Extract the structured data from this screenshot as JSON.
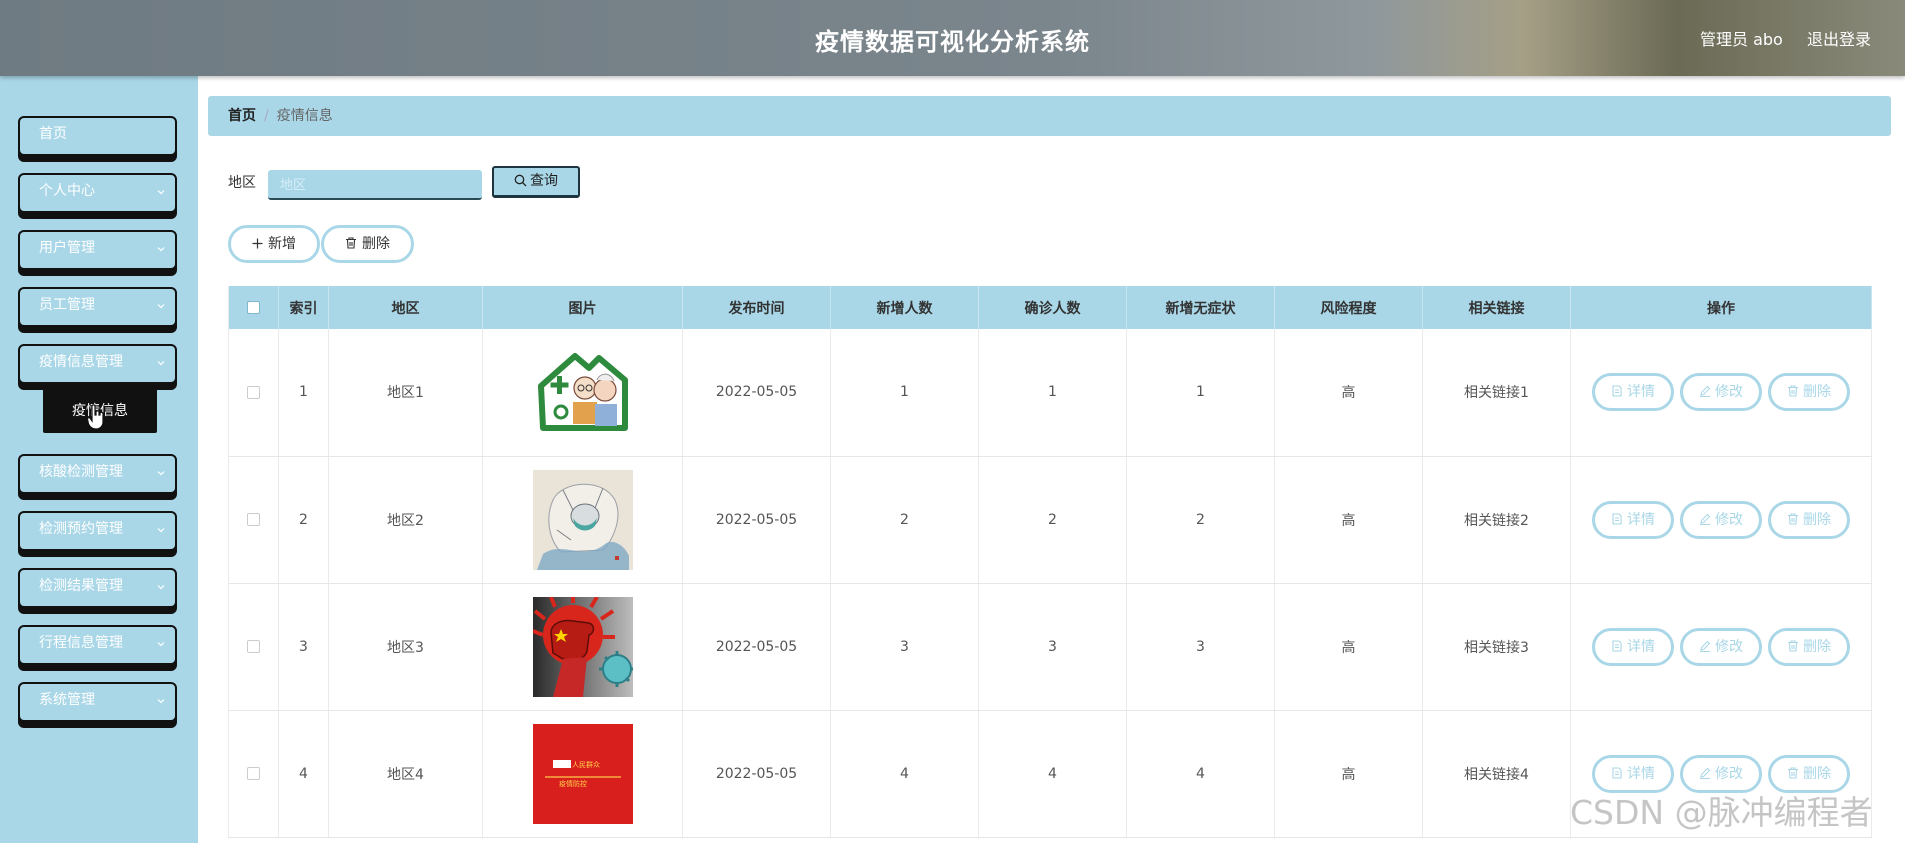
{
  "header": {
    "title": "疫情数据可视化分析系统",
    "user": "管理员 abo",
    "logout": "退出登录"
  },
  "sidebar": {
    "items": [
      {
        "label": "首页",
        "has_arrow": false
      },
      {
        "label": "个人中心",
        "has_arrow": true
      },
      {
        "label": "用户管理",
        "has_arrow": true
      },
      {
        "label": "员工管理",
        "has_arrow": true
      },
      {
        "label": "疫情信息管理",
        "has_arrow": true
      },
      {
        "label": "核酸检测管理",
        "has_arrow": true
      },
      {
        "label": "检测预约管理",
        "has_arrow": true
      },
      {
        "label": "检测结果管理",
        "has_arrow": true
      },
      {
        "label": "行程信息管理",
        "has_arrow": true
      },
      {
        "label": "系统管理",
        "has_arrow": true
      }
    ],
    "active_sub": "疫情信息"
  },
  "breadcrumb": {
    "home": "首页",
    "sep": "/",
    "current": "疫情信息"
  },
  "search": {
    "label": "地区",
    "placeholder": "地区",
    "button": "查询"
  },
  "actions": {
    "add": "新增",
    "delete": "删除"
  },
  "table": {
    "headers": [
      "索引",
      "地区",
      "图片",
      "发布时间",
      "新增人数",
      "确诊人数",
      "新增无症状",
      "风险程度",
      "相关链接",
      "操作"
    ],
    "rows": [
      {
        "index": "1",
        "region": "地区1",
        "image": "family-house-illustration",
        "date": "2022-05-05",
        "new": "1",
        "confirmed": "1",
        "asymptomatic": "1",
        "risk": "高",
        "link": "相关链接1"
      },
      {
        "index": "2",
        "region": "地区2",
        "image": "medic-sketch-illustration",
        "date": "2022-05-05",
        "new": "2",
        "confirmed": "2",
        "asymptomatic": "2",
        "risk": "高",
        "link": "相关链接2"
      },
      {
        "index": "3",
        "region": "地区3",
        "image": "fist-vs-virus-illustration",
        "date": "2022-05-05",
        "new": "3",
        "confirmed": "3",
        "asymptomatic": "3",
        "risk": "高",
        "link": "相关链接3"
      },
      {
        "index": "4",
        "region": "地区4",
        "image": "red-slogan-poster",
        "date": "2022-05-05",
        "new": "4",
        "confirmed": "4",
        "asymptomatic": "4",
        "risk": "高",
        "link": "相关链接4"
      }
    ],
    "row_actions": {
      "detail": "详情",
      "edit": "修改",
      "delete": "删除"
    }
  },
  "poster_text": {
    "line1": "人民群众",
    "line2": "疫情防控"
  },
  "watermark": "CSDN @脉冲编程者",
  "colors": {
    "accent": "#a9d7e8",
    "header": "#7a858c",
    "menu_shadow": "#111111"
  }
}
